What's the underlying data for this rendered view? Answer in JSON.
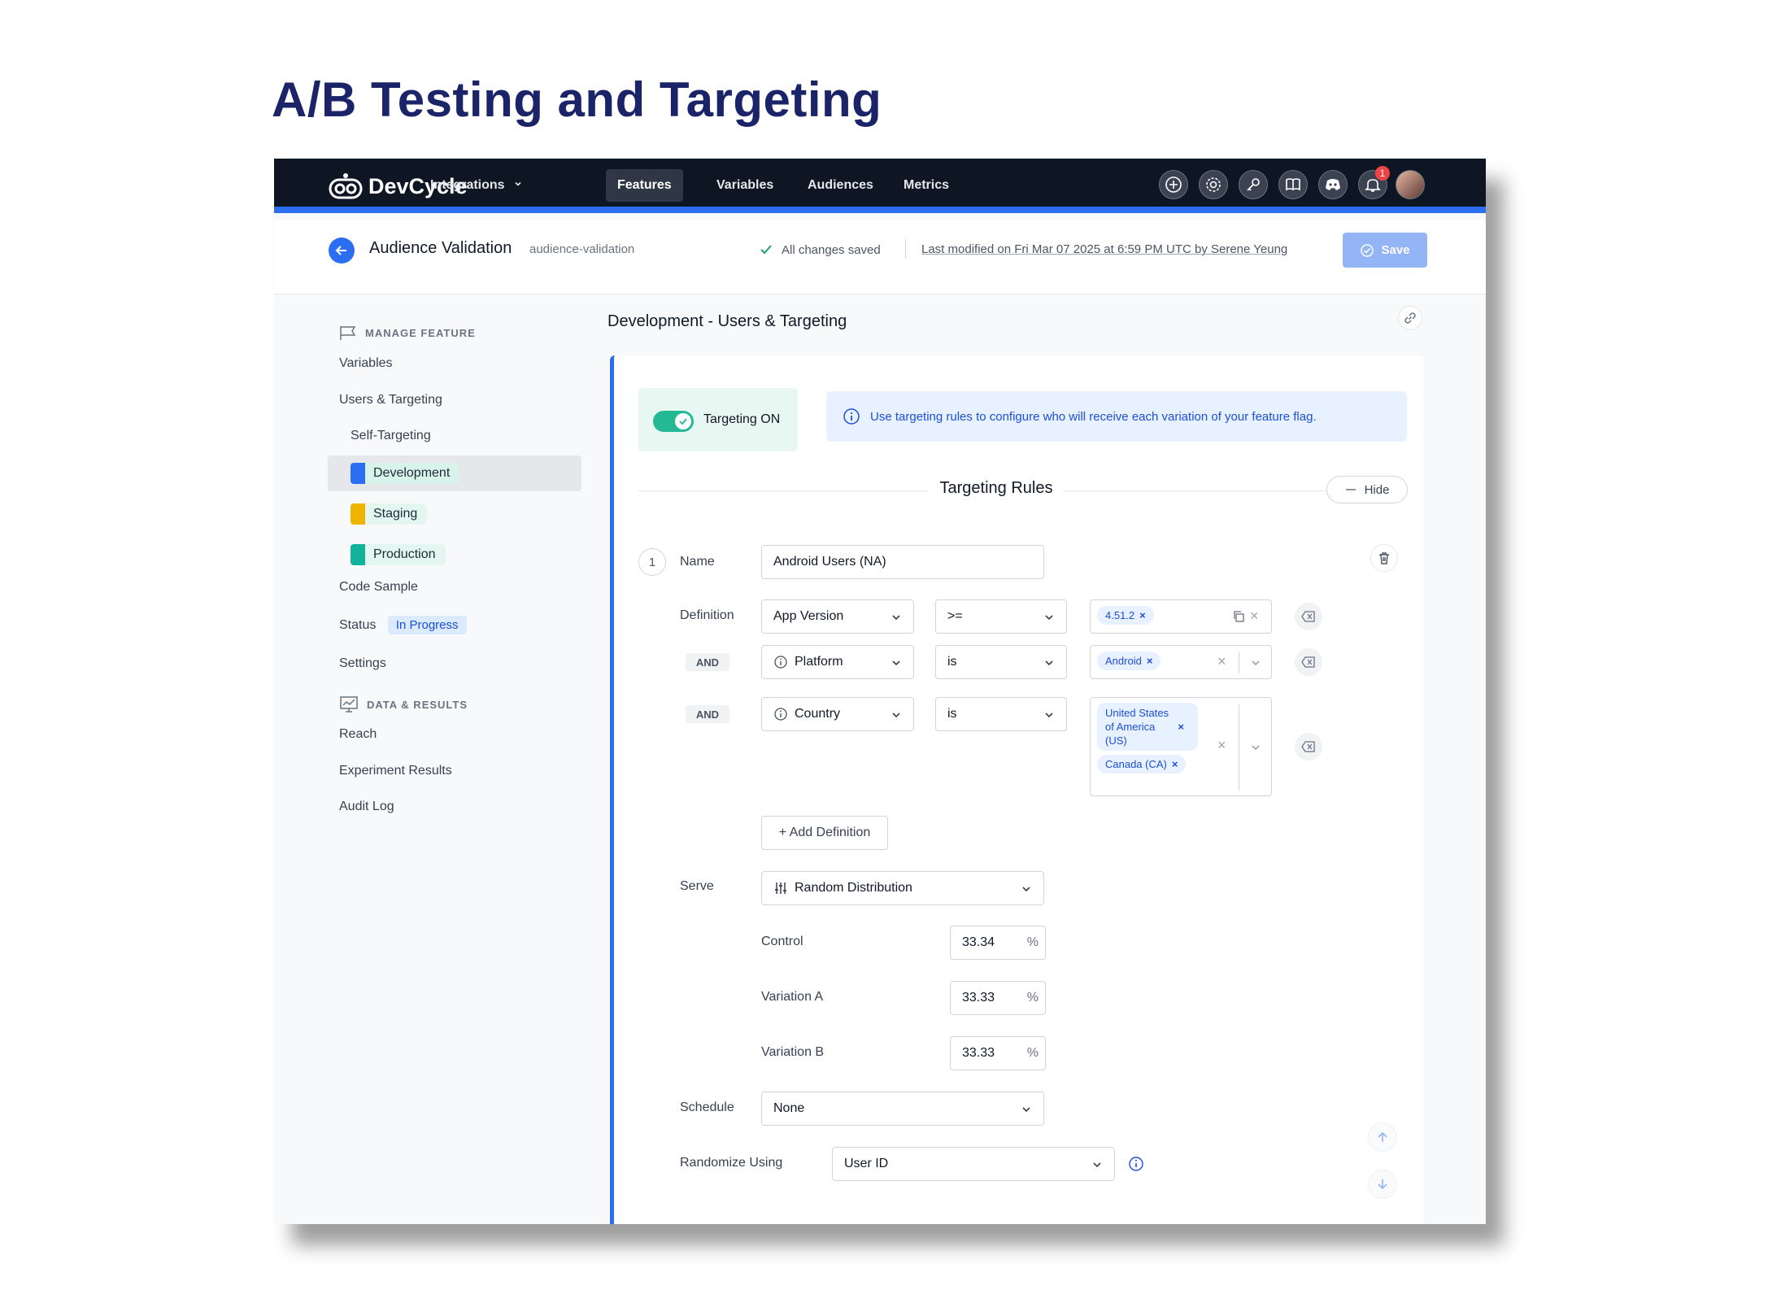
{
  "slide": {
    "title": "A/B Testing and Targeting"
  },
  "app": {
    "name": "DevCycle"
  },
  "nav": {
    "integrations": "Integrations",
    "features": "Features",
    "variables": "Variables",
    "audiences": "Audiences",
    "metrics": "Metrics",
    "notification_count": "1"
  },
  "header": {
    "feature_name": "Audience Validation",
    "feature_key": "audience-validation",
    "saved_status": "All changes saved",
    "last_modified": "Last modified on Fri Mar 07 2025 at 6:59 PM UTC by Serene Yeung",
    "save_label": "Save"
  },
  "sidebar": {
    "manage_section": "MANAGE FEATURE",
    "variables": "Variables",
    "users_targeting": "Users & Targeting",
    "self_targeting": "Self-Targeting",
    "environments": [
      {
        "label": "Development",
        "color": "#2b6ef2",
        "bg": "#e3f7f0"
      },
      {
        "label": "Staging",
        "color": "#f0b400",
        "bg": "#e3f7f0"
      },
      {
        "label": "Production",
        "color": "#12b39a",
        "bg": "#e3f7f0"
      }
    ],
    "code_sample": "Code Sample",
    "status_label": "Status",
    "status_value": "In Progress",
    "settings": "Settings",
    "data_section": "DATA & RESULTS",
    "reach": "Reach",
    "experiment_results": "Experiment Results",
    "audit_log": "Audit Log"
  },
  "main": {
    "title": "Development - Users & Targeting",
    "targeting_label": "Targeting ON",
    "info_text": "Use targeting rules to configure who will receive each variation of your feature flag.",
    "rules_title": "Targeting Rules",
    "hide_label": "Hide",
    "rule": {
      "number": "1",
      "name_label": "Name",
      "name_value": "Android Users (NA)",
      "definition_label": "Definition",
      "and_label": "AND",
      "definitions": [
        {
          "property": "App Version",
          "operator": ">=",
          "values": [
            "4.51.2"
          ]
        },
        {
          "property": "Platform",
          "operator": "is",
          "values": [
            "Android"
          ]
        },
        {
          "property": "Country",
          "operator": "is",
          "values": [
            "United States of America (US)",
            "Canada (CA)"
          ]
        }
      ],
      "add_definition": "+ Add Definition",
      "serve_label": "Serve",
      "serve_value": "Random Distribution",
      "variations": [
        {
          "name": "Control",
          "percent": "33.34"
        },
        {
          "name": "Variation A",
          "percent": "33.33"
        },
        {
          "name": "Variation B",
          "percent": "33.33"
        }
      ],
      "percent_sign": "%",
      "schedule_label": "Schedule",
      "schedule_value": "None",
      "randomize_label": "Randomize Using",
      "randomize_value": "User ID"
    }
  },
  "chip_parts": {
    "us_line1": "United States",
    "us_line2": "of America",
    "us_line3": "(US)"
  },
  "colors": {
    "accent": "#2b6ef2",
    "nav_bg": "#0f1623",
    "toggle_on": "#24b894"
  }
}
